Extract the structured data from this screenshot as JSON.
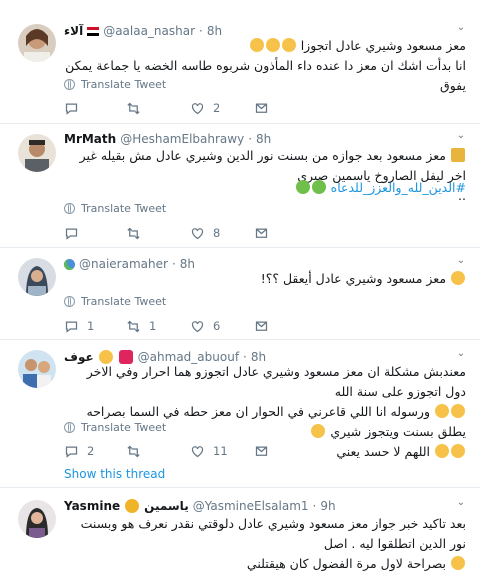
{
  "tweets": [
    {
      "name": "آلاء",
      "handle": "@aalaa_nashar",
      "time": "8h",
      "text_line1": "معز مسعود وشيري عادل اتجوزا",
      "text_line2": "انا بدأت اشك ان معز دا عنده داء المأذون شربوه طاسه الخضه يا جماعة يمكن يفوق",
      "translate": "Translate Tweet",
      "replies": "",
      "retweets": "",
      "likes": "2"
    },
    {
      "name": "MrMath",
      "handle": "@HeshamElbahrawy",
      "time": "8h",
      "text_line1": "معز مسعود بعد جوازه من بسنت نور الدين وشيري عادل مش بقيله غير اخر ليفل الصاروخ ياسمين صبري",
      "text_line2": "..",
      "hashtag": "#الدين_لله_والعزز_للدعاه",
      "translate": "Translate Tweet",
      "replies": "",
      "retweets": "",
      "likes": "8"
    },
    {
      "name": "",
      "handle": "@naieramaher",
      "time": "8h",
      "text_line1": "معز مسعود وشيري عادل أيعقل ؟؟!",
      "translate": "Translate Tweet",
      "replies": "1",
      "retweets": "1",
      "likes": "6"
    },
    {
      "name": "عوف",
      "handle": "@ahmad_abuouf",
      "time": "8h",
      "text_line1": "معندبش مشكلة ان معز مسعود وشيري عادل اتجوزو هما احرار وفي الاخر دول اتجوزو على سنة الله",
      "text_line2": "ورسوله انا اللي قاعرني في الحوار ان معز حطه في السما بصراحه يطلق بسنت ويتجوز شيري",
      "text_line3": "اللهم لا حسد يعني",
      "translate": "Translate Tweet",
      "replies": "2",
      "retweets": "",
      "likes": "11",
      "show_thread": "Show this thread"
    },
    {
      "name": "Yasmine",
      "name_ar": "ياسمين",
      "handle": "@YasmineElsalam1",
      "time": "9h",
      "text_line1": "بعد تاكيد خبر جواز معز مسعود وشيري عادل دلوقتي نقدر نعرف هو وبسنت نور الدين اتطلقوا ليه . اصل",
      "text_line2": "بصراحة لاول مرة الفضول كان هيقتلني"
    }
  ],
  "colors": {
    "link": "#1b95e0",
    "muted": "#657786",
    "border": "#e6ecf0"
  },
  "icons": [
    "reply-icon",
    "retweet-icon",
    "like-icon",
    "dm-icon",
    "globe-icon",
    "caret-down-icon"
  ]
}
